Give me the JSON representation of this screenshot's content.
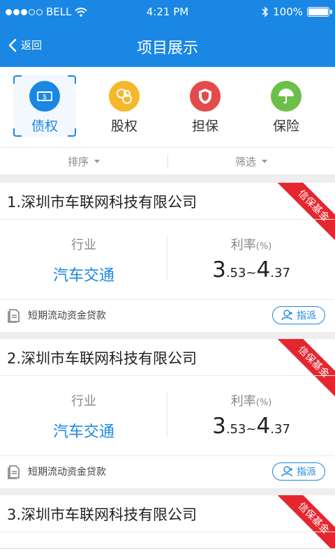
{
  "status": {
    "carrier": "BELL",
    "time": "4:21 PM",
    "battery": "100%"
  },
  "nav": {
    "back": "返回",
    "title": "项目展示"
  },
  "categories": [
    {
      "label": "债权",
      "color": "#1a87e4",
      "icon": "wallet-icon",
      "active": true
    },
    {
      "label": "股权",
      "color": "#f4b82a",
      "icon": "equity-icon",
      "active": false
    },
    {
      "label": "担保",
      "color": "#e34a4a",
      "icon": "shield-icon",
      "active": false
    },
    {
      "label": "保险",
      "color": "#6cc04a",
      "icon": "umbrella-icon",
      "active": false
    }
  ],
  "filters": {
    "sort": "排序",
    "filter": "筛选"
  },
  "projects": [
    {
      "name": "1.深圳市车联网科技有限公司",
      "industry_label": "行业",
      "industry": "汽车交通",
      "rate_label": "利率",
      "rate_unit": "(%)",
      "rate_min_int": "3",
      "rate_min_dec": ".53",
      "rate_sep": "~",
      "rate_max_int": "4",
      "rate_max_dec": ".37",
      "purpose": "短期流动资金贷款",
      "assign": "指派",
      "ribbon": "信保基金"
    },
    {
      "name": "2.深圳市车联网科技有限公司",
      "industry_label": "行业",
      "industry": "汽车交通",
      "rate_label": "利率",
      "rate_unit": "(%)",
      "rate_min_int": "3",
      "rate_min_dec": ".53",
      "rate_sep": "~",
      "rate_max_int": "4",
      "rate_max_dec": ".37",
      "purpose": "短期流动资金贷款",
      "assign": "指派",
      "ribbon": "信保基金"
    },
    {
      "name": "3.深圳市车联网科技有限公司",
      "ribbon": "信保基金"
    }
  ],
  "colors": {
    "primary": "#1a87e4",
    "ribbon": "#e5262f"
  }
}
